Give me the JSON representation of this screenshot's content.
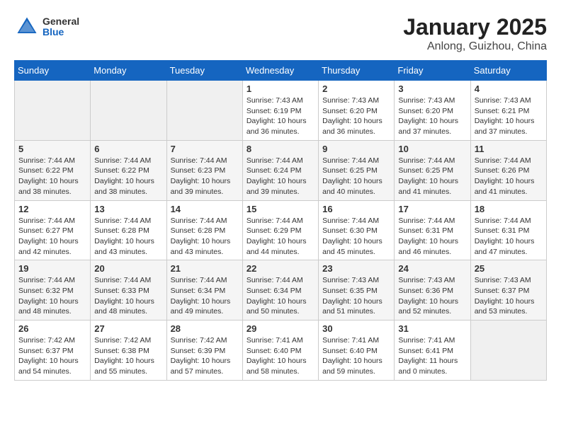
{
  "header": {
    "logo_general": "General",
    "logo_blue": "Blue",
    "month_title": "January 2025",
    "location": "Anlong, Guizhou, China"
  },
  "weekdays": [
    "Sunday",
    "Monday",
    "Tuesday",
    "Wednesday",
    "Thursday",
    "Friday",
    "Saturday"
  ],
  "weeks": [
    [
      {
        "day": "",
        "info": ""
      },
      {
        "day": "",
        "info": ""
      },
      {
        "day": "",
        "info": ""
      },
      {
        "day": "1",
        "info": "Sunrise: 7:43 AM\nSunset: 6:19 PM\nDaylight: 10 hours\nand 36 minutes."
      },
      {
        "day": "2",
        "info": "Sunrise: 7:43 AM\nSunset: 6:20 PM\nDaylight: 10 hours\nand 36 minutes."
      },
      {
        "day": "3",
        "info": "Sunrise: 7:43 AM\nSunset: 6:20 PM\nDaylight: 10 hours\nand 37 minutes."
      },
      {
        "day": "4",
        "info": "Sunrise: 7:43 AM\nSunset: 6:21 PM\nDaylight: 10 hours\nand 37 minutes."
      }
    ],
    [
      {
        "day": "5",
        "info": "Sunrise: 7:44 AM\nSunset: 6:22 PM\nDaylight: 10 hours\nand 38 minutes."
      },
      {
        "day": "6",
        "info": "Sunrise: 7:44 AM\nSunset: 6:22 PM\nDaylight: 10 hours\nand 38 minutes."
      },
      {
        "day": "7",
        "info": "Sunrise: 7:44 AM\nSunset: 6:23 PM\nDaylight: 10 hours\nand 39 minutes."
      },
      {
        "day": "8",
        "info": "Sunrise: 7:44 AM\nSunset: 6:24 PM\nDaylight: 10 hours\nand 39 minutes."
      },
      {
        "day": "9",
        "info": "Sunrise: 7:44 AM\nSunset: 6:25 PM\nDaylight: 10 hours\nand 40 minutes."
      },
      {
        "day": "10",
        "info": "Sunrise: 7:44 AM\nSunset: 6:25 PM\nDaylight: 10 hours\nand 41 minutes."
      },
      {
        "day": "11",
        "info": "Sunrise: 7:44 AM\nSunset: 6:26 PM\nDaylight: 10 hours\nand 41 minutes."
      }
    ],
    [
      {
        "day": "12",
        "info": "Sunrise: 7:44 AM\nSunset: 6:27 PM\nDaylight: 10 hours\nand 42 minutes."
      },
      {
        "day": "13",
        "info": "Sunrise: 7:44 AM\nSunset: 6:28 PM\nDaylight: 10 hours\nand 43 minutes."
      },
      {
        "day": "14",
        "info": "Sunrise: 7:44 AM\nSunset: 6:28 PM\nDaylight: 10 hours\nand 43 minutes."
      },
      {
        "day": "15",
        "info": "Sunrise: 7:44 AM\nSunset: 6:29 PM\nDaylight: 10 hours\nand 44 minutes."
      },
      {
        "day": "16",
        "info": "Sunrise: 7:44 AM\nSunset: 6:30 PM\nDaylight: 10 hours\nand 45 minutes."
      },
      {
        "day": "17",
        "info": "Sunrise: 7:44 AM\nSunset: 6:31 PM\nDaylight: 10 hours\nand 46 minutes."
      },
      {
        "day": "18",
        "info": "Sunrise: 7:44 AM\nSunset: 6:31 PM\nDaylight: 10 hours\nand 47 minutes."
      }
    ],
    [
      {
        "day": "19",
        "info": "Sunrise: 7:44 AM\nSunset: 6:32 PM\nDaylight: 10 hours\nand 48 minutes."
      },
      {
        "day": "20",
        "info": "Sunrise: 7:44 AM\nSunset: 6:33 PM\nDaylight: 10 hours\nand 48 minutes."
      },
      {
        "day": "21",
        "info": "Sunrise: 7:44 AM\nSunset: 6:34 PM\nDaylight: 10 hours\nand 49 minutes."
      },
      {
        "day": "22",
        "info": "Sunrise: 7:44 AM\nSunset: 6:34 PM\nDaylight: 10 hours\nand 50 minutes."
      },
      {
        "day": "23",
        "info": "Sunrise: 7:43 AM\nSunset: 6:35 PM\nDaylight: 10 hours\nand 51 minutes."
      },
      {
        "day": "24",
        "info": "Sunrise: 7:43 AM\nSunset: 6:36 PM\nDaylight: 10 hours\nand 52 minutes."
      },
      {
        "day": "25",
        "info": "Sunrise: 7:43 AM\nSunset: 6:37 PM\nDaylight: 10 hours\nand 53 minutes."
      }
    ],
    [
      {
        "day": "26",
        "info": "Sunrise: 7:42 AM\nSunset: 6:37 PM\nDaylight: 10 hours\nand 54 minutes."
      },
      {
        "day": "27",
        "info": "Sunrise: 7:42 AM\nSunset: 6:38 PM\nDaylight: 10 hours\nand 55 minutes."
      },
      {
        "day": "28",
        "info": "Sunrise: 7:42 AM\nSunset: 6:39 PM\nDaylight: 10 hours\nand 57 minutes."
      },
      {
        "day": "29",
        "info": "Sunrise: 7:41 AM\nSunset: 6:40 PM\nDaylight: 10 hours\nand 58 minutes."
      },
      {
        "day": "30",
        "info": "Sunrise: 7:41 AM\nSunset: 6:40 PM\nDaylight: 10 hours\nand 59 minutes."
      },
      {
        "day": "31",
        "info": "Sunrise: 7:41 AM\nSunset: 6:41 PM\nDaylight: 11 hours\nand 0 minutes."
      },
      {
        "day": "",
        "info": ""
      }
    ]
  ]
}
